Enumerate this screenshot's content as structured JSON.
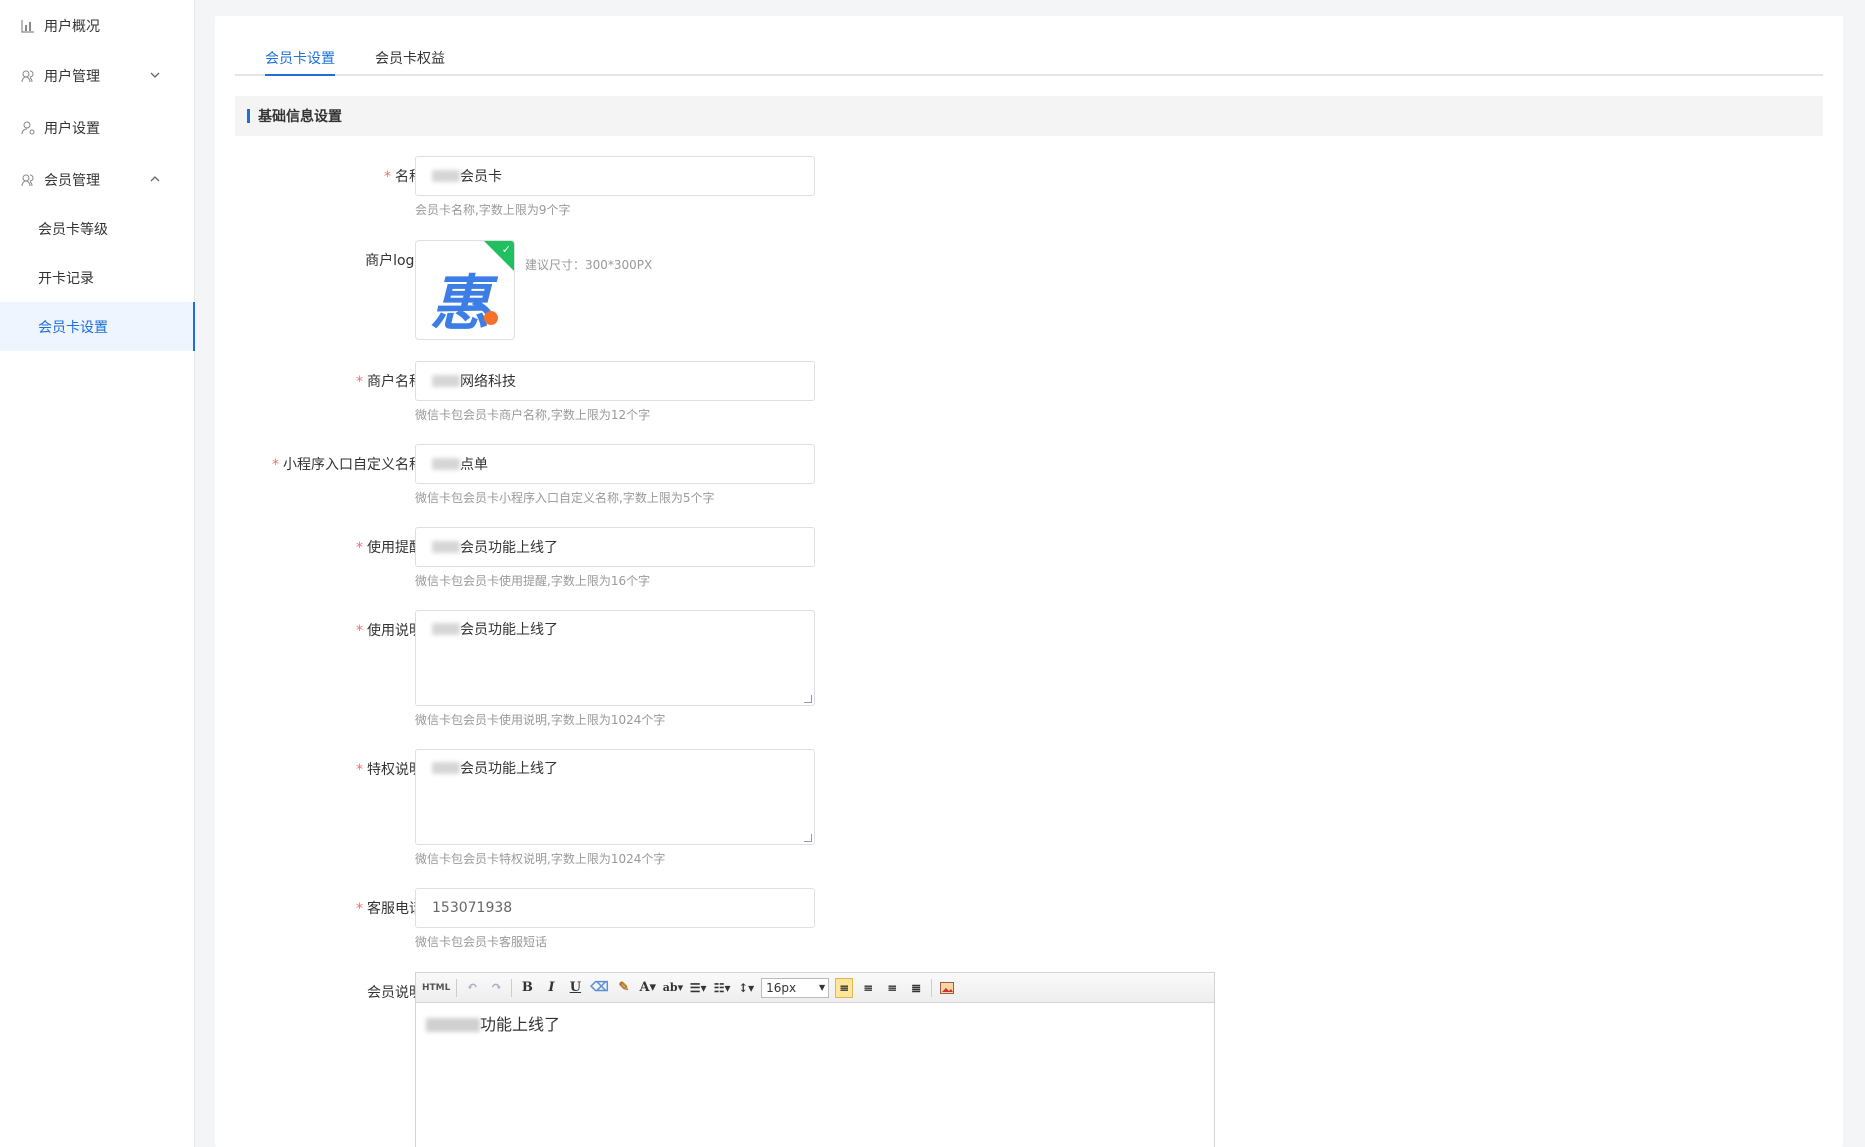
{
  "sidebar": {
    "items": [
      {
        "label": "用户概况",
        "icon": "bar-chart-icon"
      },
      {
        "label": "用户管理",
        "icon": "users-icon"
      },
      {
        "label": "用户设置",
        "icon": "user-gear-icon"
      },
      {
        "label": "会员管理",
        "icon": "users-icon"
      }
    ],
    "sub_items": [
      {
        "label": "会员卡等级"
      },
      {
        "label": "开卡记录"
      },
      {
        "label": "会员卡设置"
      }
    ]
  },
  "tabs": [
    {
      "label": "会员卡设置"
    },
    {
      "label": "会员卡权益"
    }
  ],
  "section_title": "基础信息设置",
  "form": {
    "name": {
      "label": "名称",
      "value": "会员卡",
      "hint": "会员卡名称,字数上限为9个字"
    },
    "logo": {
      "label": "商户logo",
      "hint": "建议尺寸：300*300PX",
      "glyph": "惠"
    },
    "merchant_name": {
      "label": "商户名称",
      "value": "网络科技",
      "hint": "微信卡包会员卡商户名称,字数上限为12个字"
    },
    "mini_entry": {
      "label": "小程序入口自定义名称",
      "value": "点单",
      "hint": "微信卡包会员卡小程序入口自定义名称,字数上限为5个字"
    },
    "usage_tip": {
      "label": "使用提醒",
      "value": "会员功能上线了",
      "hint": "微信卡包会员卡使用提醒,字数上限为16个字"
    },
    "usage_desc": {
      "label": "使用说明",
      "value": "会员功能上线了",
      "hint": "微信卡包会员卡使用说明,字数上限为1024个字"
    },
    "privilege_desc": {
      "label": "特权说明",
      "value": "会员功能上线了",
      "hint": "微信卡包会员卡特权说明,字数上限为1024个字"
    },
    "service_phone": {
      "label": "客服电话",
      "value": "153071938",
      "hint": "微信卡包会员卡客服短话"
    },
    "member_desc": {
      "label": "会员说明",
      "value": "功能上线了",
      "font_size": "16px",
      "html_label": "HTML"
    }
  },
  "colors": {
    "accent": "#1e6fd9",
    "required": "#f56c6c"
  }
}
